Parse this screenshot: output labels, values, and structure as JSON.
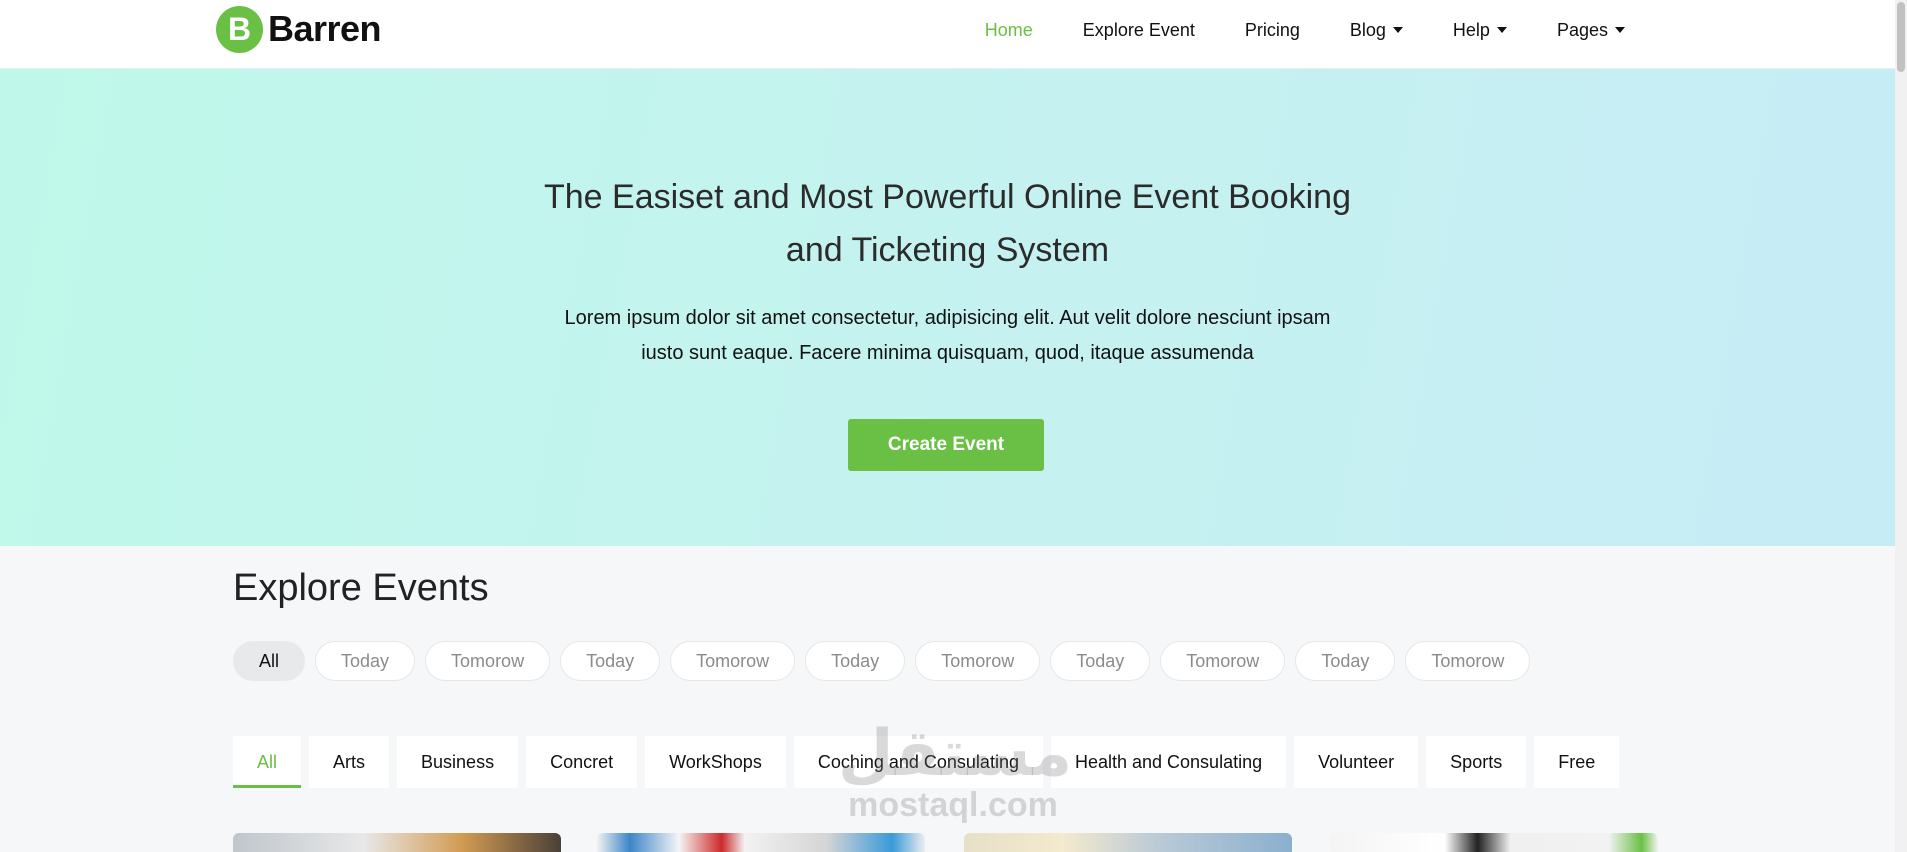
{
  "brand": {
    "logo_letter": "B",
    "name": "Barren",
    "accent_color": "#6ac045"
  },
  "nav": {
    "items": [
      {
        "label": "Home",
        "active": true,
        "dropdown": false
      },
      {
        "label": "Explore Event",
        "active": false,
        "dropdown": false
      },
      {
        "label": "Pricing",
        "active": false,
        "dropdown": false
      },
      {
        "label": "Blog",
        "active": false,
        "dropdown": true
      },
      {
        "label": "Help",
        "active": false,
        "dropdown": true
      },
      {
        "label": "Pages",
        "active": false,
        "dropdown": true
      }
    ]
  },
  "hero": {
    "title_line1": "The Easiset and Most Powerful Online Event Booking",
    "title_line2": "and Ticketing System",
    "text_line1": "Lorem ipsum dolor sit amet consectetur, adipisicing elit. Aut velit dolore nesciunt ipsam",
    "text_line2": "iusto sunt eaque. Facere minima quisquam, quod, itaque assumenda",
    "cta_label": "Create Event"
  },
  "explore": {
    "title": "Explore Events",
    "day_filters": [
      "All",
      "Today",
      "Tomorow",
      "Today",
      "Tomorow",
      "Today",
      "Tomorow",
      "Today",
      "Tomorow",
      "Today",
      "Tomorow"
    ],
    "day_active": "All",
    "categories": [
      "All",
      "Arts",
      "Business",
      "Concret",
      "WorkShops",
      "Coching and Consulating",
      "Health and Consulating",
      "Volunteer",
      "Sports",
      "Free"
    ],
    "category_active": "All"
  },
  "watermark": {
    "arabic": "مستقل",
    "latin": "mostaql.com"
  },
  "colors": {
    "hero_start": "#bff8ea",
    "hero_end": "#c6ecf6",
    "page_bg": "#f5f7f9"
  }
}
